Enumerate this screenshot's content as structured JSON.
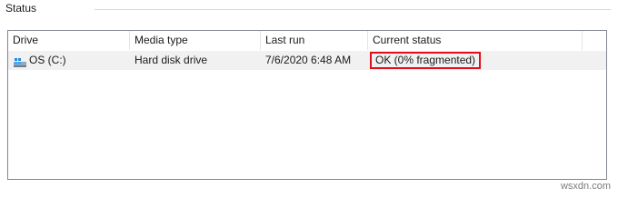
{
  "group": {
    "title": "Status"
  },
  "columns": [
    "Drive",
    "Media type",
    "Last run",
    "Current status"
  ],
  "rows": [
    {
      "drive": "OS (C:)",
      "media_type": "Hard disk drive",
      "last_run": "7/6/2020 6:48 AM",
      "current_status": "OK (0% fragmented)"
    }
  ],
  "icons": {
    "drive": "windows-drive-icon"
  },
  "colors": {
    "highlight_box": "#e0101a",
    "row_background": "#f1f1f1"
  },
  "watermark": "wsxdn.com"
}
